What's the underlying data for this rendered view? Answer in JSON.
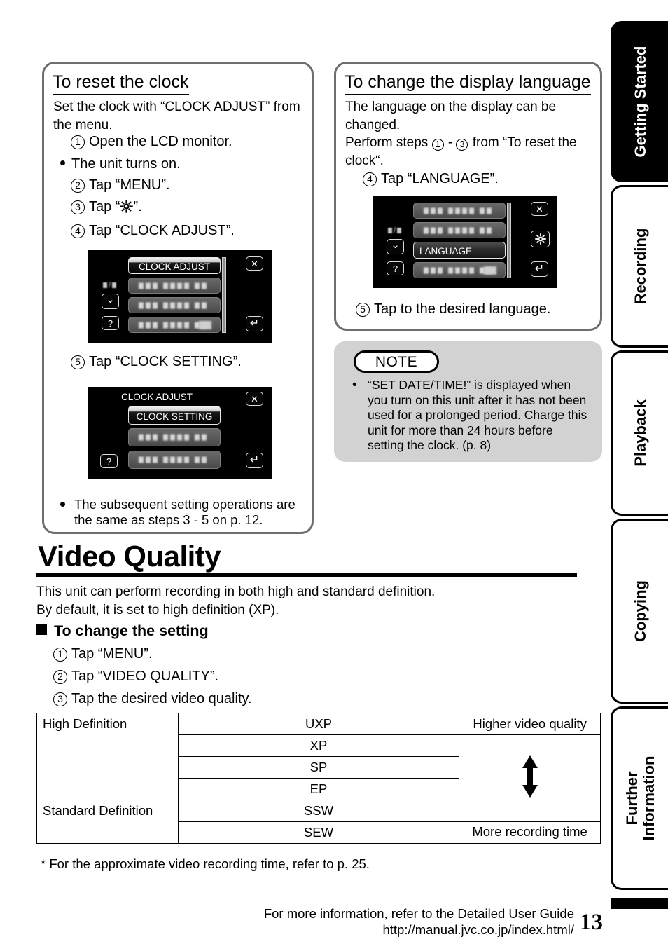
{
  "left_panel": {
    "title": "To reset the clock",
    "intro": "Set the clock with “CLOCK ADJUST” from the menu.",
    "step1": "Open the LCD monitor.",
    "bullet1": "The unit turns on.",
    "step2": "Tap “MENU”.",
    "step3_prefix": "Tap “",
    "step3_suffix": "”.",
    "step4": "Tap “CLOCK ADJUST”.",
    "step5": "Tap “CLOCK SETTING”.",
    "closing_bullet": "The subsequent setting operations are the same as steps 3 - 5 on p. 12.",
    "numbers": {
      "n1": "1",
      "n2": "2",
      "n3": "3",
      "n4": "4",
      "n5": "5"
    },
    "screen1": {
      "highlight_row": "CLOCK ADJUST",
      "page_indicator": "/",
      "help_label": "?",
      "close_label": "✕",
      "back_label": "↵",
      "down_label": "⌄"
    },
    "screen2": {
      "title": "CLOCK ADJUST",
      "highlight_row": "CLOCK SETTING",
      "help_label": "?",
      "close_label": "✕",
      "back_label": "↵"
    }
  },
  "right_panel": {
    "title": "To change the display language",
    "intro1": "The language on the display can be changed.",
    "intro2_a": "Perform steps ",
    "intro2_b": " - ",
    "intro2_c": " from “To reset the clock“.",
    "step4": "Tap “LANGUAGE”.",
    "step5": "Tap to the desired language.",
    "numbers": {
      "n1": "1",
      "n3": "3",
      "n4": "4",
      "n5": "5"
    },
    "screen": {
      "highlight_row": "LANGUAGE",
      "page_indicator": "/",
      "help_label": "?",
      "close_label": "✕",
      "back_label": "↵",
      "down_label": "⌄",
      "gear_label": "gear"
    }
  },
  "note": {
    "label": "NOTE",
    "text": "“SET DATE/TIME!” is displayed when you turn on this unit after it has not been used for a prolonged period. Charge this unit for more than 24 hours before setting the clock. (p. 8)"
  },
  "video_quality": {
    "heading": "Video Quality",
    "intro_line1": "This unit can perform recording in both high and standard definition.",
    "intro_line2": "By default, it is set to high definition (XP).",
    "subheading": "To change the setting",
    "step1": "Tap “MENU”.",
    "step2": "Tap “VIDEO QUALITY”.",
    "step3": "Tap the desired video quality.",
    "numbers": {
      "n1": "1",
      "n2": "2",
      "n3": "3"
    },
    "footnote": "*  For the approximate video recording time, refer to p. 25.",
    "table": {
      "rows": [
        {
          "definition": "High Definition",
          "mode": "UXP",
          "note": "Higher video quality"
        },
        {
          "definition": "",
          "mode": "XP",
          "note": ""
        },
        {
          "definition": "",
          "mode": "SP",
          "note": ""
        },
        {
          "definition": "",
          "mode": "EP",
          "note": ""
        },
        {
          "definition": "Standard Definition",
          "mode": "SSW",
          "note": ""
        },
        {
          "definition": "",
          "mode": "SEW",
          "note": "More recording time"
        }
      ]
    }
  },
  "tabs": [
    {
      "label": "Getting Started",
      "active": true
    },
    {
      "label": "Recording",
      "active": false
    },
    {
      "label": "Playback",
      "active": false
    },
    {
      "label": "Copying",
      "active": false
    },
    {
      "label": "Further\nInformation",
      "active": false
    }
  ],
  "footer": {
    "line1": "For more information, refer to the Detailed User Guide",
    "line2": "http://manual.jvc.co.jp/index.html/",
    "page_number": "13"
  },
  "colors": {
    "panel_border": "#6e6e6e",
    "note_background": "#d2d2d2",
    "tab_active_background": "#000000",
    "lcd_background": "#000000"
  }
}
